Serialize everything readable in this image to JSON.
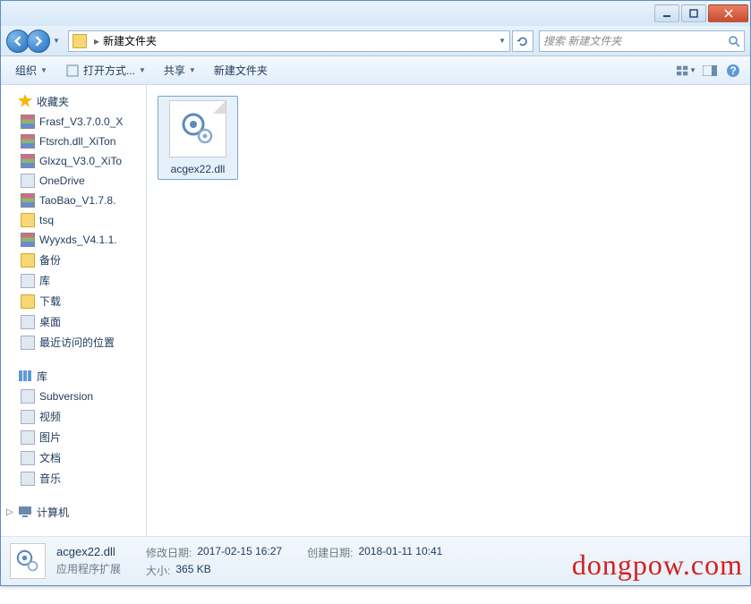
{
  "breadcrumb": {
    "folder": "新建文件夹"
  },
  "search": {
    "placeholder": "搜索 新建文件夹"
  },
  "toolbar": {
    "organize": "组织",
    "openwith": "打开方式...",
    "share": "共享",
    "newfolder": "新建文件夹"
  },
  "sidebar": {
    "favorites": {
      "title": "收藏夹",
      "items": [
        "Frasf_V3.7.0.0_X",
        "Ftsrch.dll_XiTon",
        "Glxzq_V3.0_XiTo",
        "OneDrive",
        "TaoBao_V1.7.8.",
        "tsq",
        "Wyyxds_V4.1.1.",
        "备份",
        "库",
        "下载",
        "桌面",
        "最近访问的位置"
      ]
    },
    "libraries": {
      "title": "库",
      "items": [
        "Subversion",
        "视频",
        "图片",
        "文档",
        "音乐"
      ]
    },
    "computer": {
      "title": "计算机"
    }
  },
  "file": {
    "name": "acgex22.dll"
  },
  "details": {
    "name": "acgex22.dll",
    "type": "应用程序扩展",
    "modified_label": "修改日期:",
    "modified": "2017-02-15 16:27",
    "size_label": "大小:",
    "size": "365 KB",
    "created_label": "创建日期:",
    "created": "2018-01-11 10:41"
  },
  "watermark": "dongpow.com"
}
